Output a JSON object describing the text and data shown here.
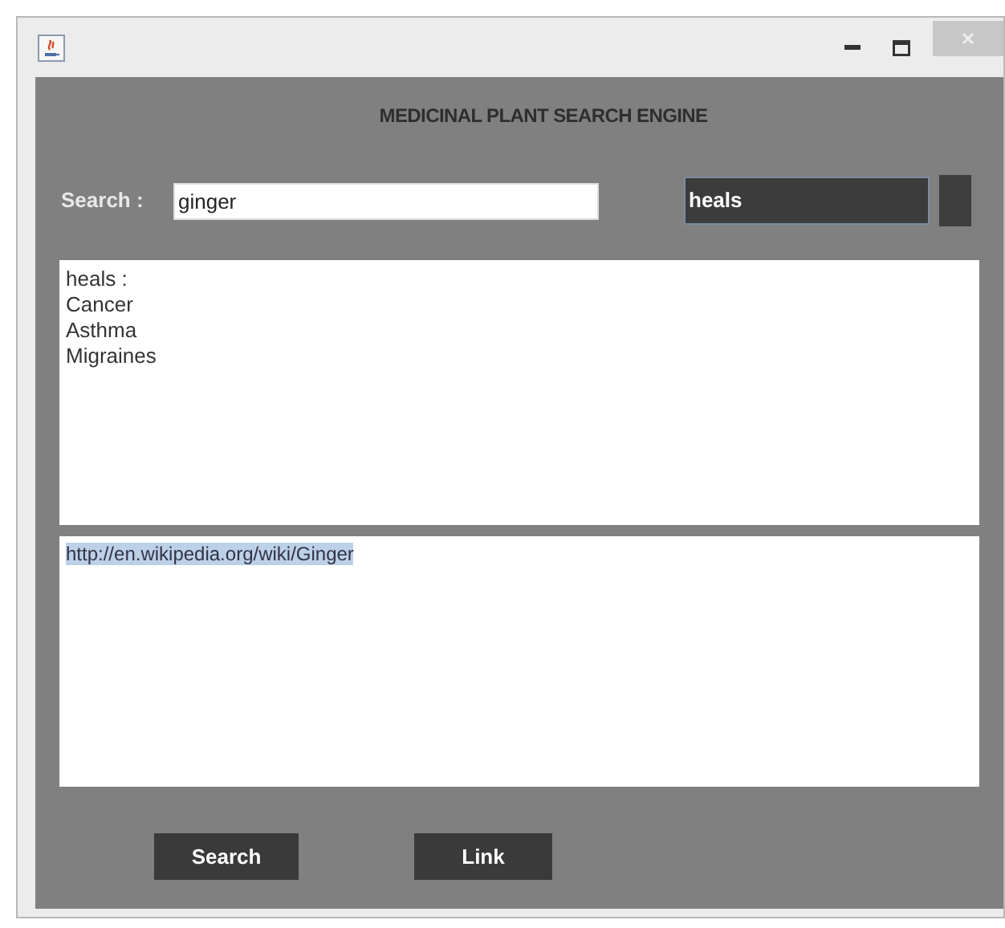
{
  "window": {
    "title": "MEDICINAL PLANT SEARCH ENGINE"
  },
  "search": {
    "label": "Search :",
    "value": "ginger"
  },
  "dropdown": {
    "value": "heals"
  },
  "results": {
    "lines": [
      "heals :",
      "Cancer",
      "Asthma",
      "Migraines"
    ]
  },
  "link_area": {
    "text": "http://en.wikipedia.org/wiki/Ginger",
    "selected": true
  },
  "buttons": [
    "Search",
    "Link"
  ]
}
